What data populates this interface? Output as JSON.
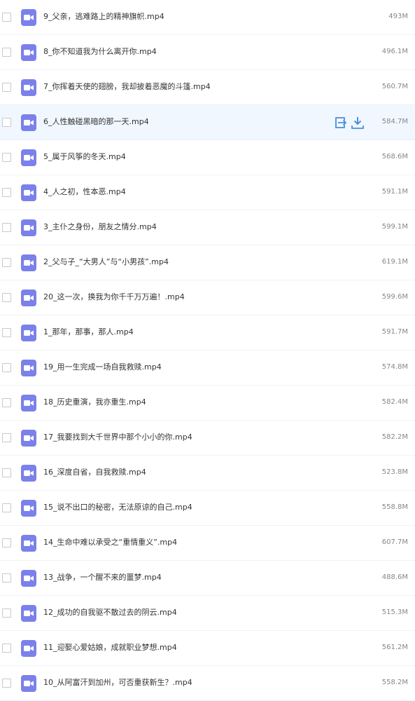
{
  "colors": {
    "icon_bg": "#7b81ea",
    "action_blue": "#4a90d9",
    "hover_row_bg": "#f1f7ff"
  },
  "row_actions": {
    "share_icon": "share-icon",
    "download_icon": "download-icon"
  },
  "files": [
    {
      "name": "9_父亲，逃难路上的精神旗帜.mp4",
      "size": "493M",
      "icon": "video-icon"
    },
    {
      "name": "8_你不知道我为什么离开你.mp4",
      "size": "496.1M",
      "icon": "video-icon"
    },
    {
      "name": "7_你挥着天使的翅膀，我却披着恶魔的斗篷.mp4",
      "size": "560.7M",
      "icon": "video-icon"
    },
    {
      "name": "6_人性触碰黑暗的那一天.mp4",
      "size": "584.7M",
      "icon": "video-icon",
      "hovered": true
    },
    {
      "name": "5_属于风筝的冬天.mp4",
      "size": "568.6M",
      "icon": "video-icon"
    },
    {
      "name": "4_人之初，性本恶.mp4",
      "size": "591.1M",
      "icon": "video-icon"
    },
    {
      "name": "3_主仆之身份，朋友之情分.mp4",
      "size": "599.1M",
      "icon": "video-icon"
    },
    {
      "name": "2_父与子_“大男人”与“小男孩”.mp4",
      "size": "619.1M",
      "icon": "video-icon"
    },
    {
      "name": "20_这一次，换我为你千千万万遍！.mp4",
      "size": "599.6M",
      "icon": "video-icon"
    },
    {
      "name": "1_那年，那事，那人.mp4",
      "size": "591.7M",
      "icon": "video-icon"
    },
    {
      "name": "19_用一生完成一场自我救赎.mp4",
      "size": "574.8M",
      "icon": "video-icon"
    },
    {
      "name": "18_历史重演，我亦重生.mp4",
      "size": "582.4M",
      "icon": "video-icon"
    },
    {
      "name": "17_我要找到大千世界中那个小小的你.mp4",
      "size": "582.2M",
      "icon": "video-icon"
    },
    {
      "name": "16_深度自省，自我救赎.mp4",
      "size": "523.8M",
      "icon": "video-icon"
    },
    {
      "name": "15_说不出口的秘密，无法原谅的自己.mp4",
      "size": "558.8M",
      "icon": "video-icon"
    },
    {
      "name": "14_生命中难以承受之“重情重义”.mp4",
      "size": "607.7M",
      "icon": "video-icon"
    },
    {
      "name": "13_战争，一个醒不来的噩梦.mp4",
      "size": "488.6M",
      "icon": "video-icon"
    },
    {
      "name": "12_成功的自我驱不散过去的阴云.mp4",
      "size": "515.3M",
      "icon": "video-icon"
    },
    {
      "name": "11_迎娶心爱姑娘，成就职业梦想.mp4",
      "size": "561.2M",
      "icon": "video-icon"
    },
    {
      "name": "10_从阿富汗到加州，可否重获新生？.mp4",
      "size": "558.2M",
      "icon": "video-icon"
    }
  ]
}
